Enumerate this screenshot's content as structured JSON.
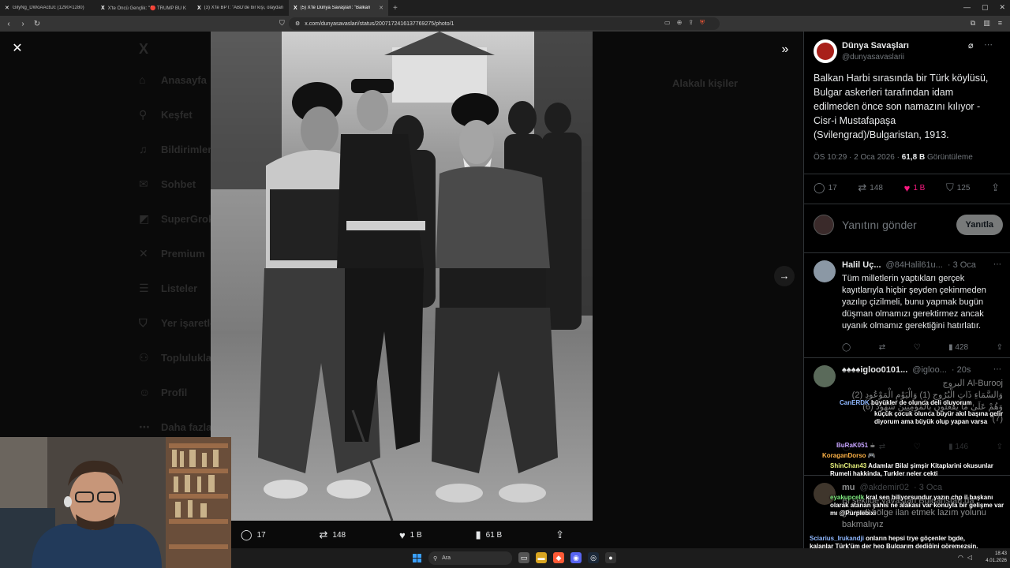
{
  "browser": {
    "tabs": [
      {
        "fav": "✕",
        "title": "GilyNg_DWoAAcbJc (1290×1280)",
        "active": false
      },
      {
        "fav": "X",
        "title": "X'te Öncü Gençlik: \"🔴 TRUMP BU K",
        "active": false
      },
      {
        "fav": "X",
        "title": "(3) X'te BPT: \"ABD'de bir kişi, olaydan",
        "active": false
      },
      {
        "fav": "X",
        "title": "(5) X'te Dünya Savaşları: \"Balkan",
        "active": true
      }
    ],
    "new_tab": "+",
    "url": "x.com/dunyasavaslari/status/2007172416137769275/photo/1"
  },
  "background": {
    "logo": "X",
    "nav": [
      "Anasayfa",
      "Keşfet",
      "Bildirimler",
      "Sohbet",
      "SuperGrok",
      "Premium",
      "Listeler",
      "Yer işaretleri",
      "Topluluklar",
      "Profil",
      "Daha fazla"
    ],
    "right_title": "Alakalı kişiler"
  },
  "photo_actions": {
    "replies": "17",
    "reposts": "148",
    "likes": "1 B",
    "views": "61 B"
  },
  "tweet": {
    "author_name": "Dünya Savaşları",
    "author_handle": "@dunyasavaslarii",
    "text": "Balkan Harbi sırasında bir Türk köylüsü, Bulgar askerleri tarafından idam edilmeden önce son namazını kılıyor - Cisr-i Mustafapaşa (Svilengrad)/Bulgaristan, 1913.",
    "time": "ÖS 10:29 · 2 Oca 2026 · ",
    "views_count": "61,8 B",
    "views_label": " Görüntüleme",
    "replies": "17",
    "reposts": "148",
    "likes": "1 B",
    "bookmarks": "125",
    "reply_placeholder": "Yanıtını gönder",
    "reply_button": "Yanıtla"
  },
  "replies": [
    {
      "name": "Halil Uç...",
      "handle": "@84Halil61u...",
      "time": "· 3 Oca",
      "text": "Tüm milletlerin yaptıkları gerçek kayıtlarıyla hiçbir şeyden çekinmeden yazılıp çizilmeli, bunu yapmak bugün düşman olmamızı gerektirmez ancak uyanık olmamız gerektiğini hatırlatır.",
      "views": "428"
    },
    {
      "name": "♠♠♠♠igloo0101...",
      "handle": "@igloo...",
      "time": "· 20s",
      "text": "البروج Al-Burooj\nوَالسَّمَاءِ ذَاتِ الْبُرُوجِ (1) وَالْيَوْمِ الْمَوْعُودِ (2)\n(6) وَهُمْ عَلَىٰ مَا يَفْعَلُونَ بِالْمُؤْمِنِينَ شُهُودٌ\n(7)",
      "views": "146"
    },
    {
      "name": "mu",
      "handle": "@akdemir02",
      "time": "· 3 Oca",
      "text": "Bi şekilde yavaştan Bulgaristan da güvenli bölge ilan etmek lazım yolunu bakmalıyız",
      "views": ""
    }
  ],
  "chat": [
    {
      "user": "CanERDK",
      "msg": "büyükler de olunca deli oluyorum",
      "color": "blue"
    },
    {
      "user": "",
      "msg": "küçük çocuk olunca büyür akıl başına gelir diyorum ama büyük olup yapan varsa",
      "color": ""
    },
    {
      "user": "BuRaK051",
      "msg": "☕",
      "color": ""
    },
    {
      "user": "KoraganDorso",
      "msg": "🎮",
      "color": "orange"
    },
    {
      "user": "ShinChan43",
      "msg": "Adamlar Bilal şimşir Kitaplarini okusunlar Rumeli hakkinda, Turkler neler cekti",
      "color": "yellow"
    },
    {
      "user": "eyakupcelk",
      "msg": "kral sen biliyorsundur yazın chp il başkanı olarak atanan şahıs ne alakası var konuyla bir gelişme var mı @Purplebixi",
      "color": "green"
    },
    {
      "user": "Sciarius_Irukandji",
      "msg": "onların hepsi trye göçenler bgde, kalanlar Türk'üm der hep Bulgarım dediğini göremezsin.",
      "color": "blue"
    }
  ],
  "taskbar": {
    "search": "Ara",
    "time": "18:43",
    "date": "4.01.2026"
  },
  "colors": {
    "accent_like": "#f91880",
    "brand_red": "#a8201a",
    "brave_orange": "#ff5a36"
  }
}
